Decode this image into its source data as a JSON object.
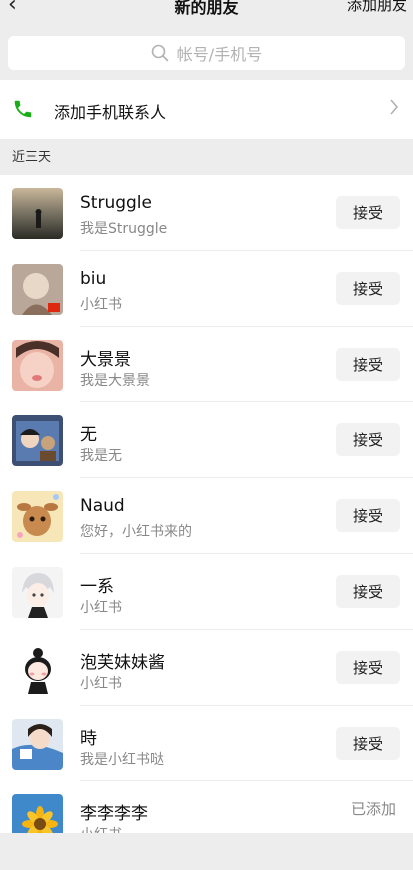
{
  "nav": {
    "back_icon": "chevron-left-icon",
    "title": "新的朋友",
    "action": "添加朋友"
  },
  "search": {
    "placeholder": "帐号/手机号",
    "icon": "search-icon"
  },
  "contacts_entry": {
    "label": "添加手机联系人",
    "icon": "phone-icon",
    "accent": "#1aad19"
  },
  "section": {
    "label": "近三天"
  },
  "requests": [
    {
      "name": "Struggle",
      "message": "我是Struggle",
      "action": "接受"
    },
    {
      "name": "biu",
      "message": "小红书",
      "action": "接受"
    },
    {
      "name": "大景景",
      "message": "我是大景景",
      "action": "接受"
    },
    {
      "name": "无",
      "message": "我是无",
      "action": "接受"
    },
    {
      "name": "Naud",
      "message": "您好，小红书来的",
      "action": "接受"
    },
    {
      "name": "一系",
      "message": "小红书",
      "action": "接受"
    },
    {
      "name": "泡芙妹妹酱",
      "message": "小红书",
      "action": "接受"
    },
    {
      "name": "時",
      "message": "我是小红书哒",
      "action": "接受"
    },
    {
      "name": "李李李李",
      "message": "小红书",
      "status": "已添加"
    }
  ]
}
